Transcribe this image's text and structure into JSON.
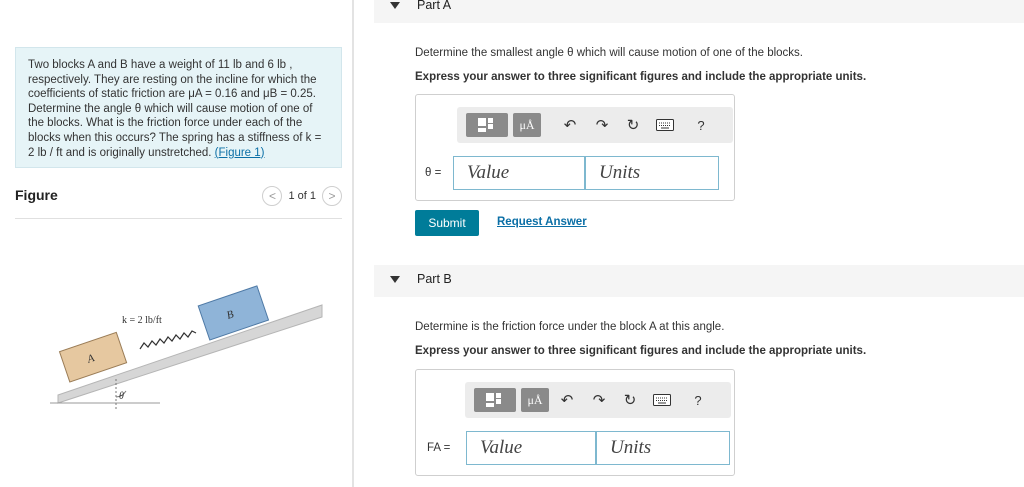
{
  "problem": {
    "text_before_link": "Two blocks A and B have a weight of 11 lb and 6 lb , respectively. They are resting on the incline for which the coefficients of static friction are μA = 0.16 and μB = 0.25. Determine the angle θ which will cause motion of one of the blocks. What is the friction force under each of the blocks when this occurs? The spring has a stiffness of k = 2 lb / ft and is originally unstretched. ",
    "link": "(Figure 1)"
  },
  "figure_panel": {
    "label": "Figure",
    "pager": "1 of 1",
    "prev_glyph": "<",
    "next_glyph": ">"
  },
  "figure": {
    "spring_label": "k = 2 lb/ft",
    "block_a": "A",
    "block_b": "B",
    "angle_label": "θ",
    "colors": {
      "block_a": "#e6c8a0",
      "block_b": "#8fb4d8"
    }
  },
  "part_a": {
    "title": "Part A",
    "question": "Determine the smallest angle θ which will cause motion of one of the blocks.",
    "instruction": "Express your answer to three significant figures and include the appropriate units.",
    "var_label": "θ =",
    "value_placeholder": "Value",
    "units_placeholder": "Units",
    "submit": "Submit",
    "request": "Request Answer"
  },
  "part_b": {
    "title": "Part B",
    "question": "Determine is the friction force under the block A at this angle.",
    "instruction": "Express your answer to three significant figures and include the appropriate units.",
    "var_label": "FA =",
    "value_placeholder": "Value",
    "units_placeholder": "Units"
  },
  "toolbar": {
    "mu_label": "μÅ",
    "undo_glyph": "↶",
    "redo_glyph": "↷",
    "reset_glyph": "↻",
    "help_glyph": "?"
  },
  "icons": [
    "templates-icon",
    "mu-units-icon",
    "undo-icon",
    "redo-icon",
    "reset-icon",
    "keyboard-icon",
    "help-icon",
    "collapse-triangle-icon"
  ],
  "accent": "#007c99",
  "link_color": "#0b6fa6"
}
